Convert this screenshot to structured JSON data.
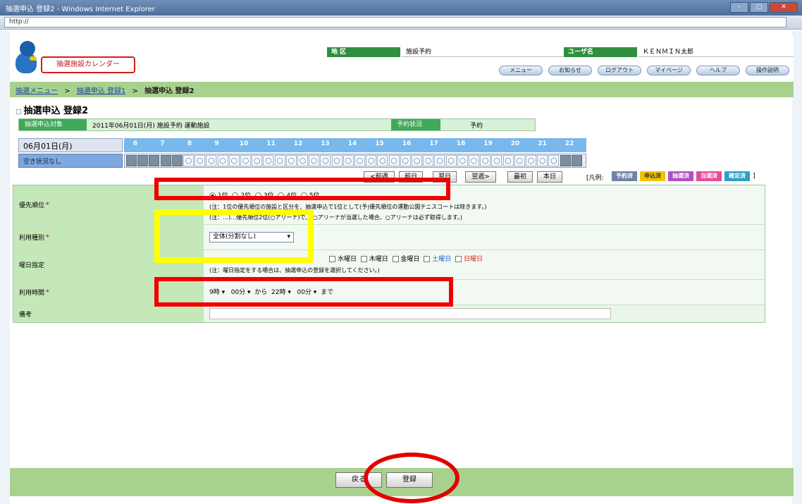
{
  "window": {
    "title": "抽選申込 登録2 - Windows Internet Explorer",
    "url": "http://"
  },
  "header": {
    "calendar_button": "抽選施設カレンダー",
    "area_label": "地 区",
    "area_value": "施設予約",
    "user_label": "ユーザ名",
    "user_value": "ＫＥＮＭＩＮ太郎",
    "nav_buttons": [
      "メニュー",
      "お知らせ",
      "ログアウト",
      "マイページ",
      "ヘルプ",
      "操作説明"
    ]
  },
  "breadcrumb": {
    "items": [
      "抽選メニュー",
      "抽選申込 登録1"
    ],
    "current": "抽選申込 登録2"
  },
  "page": {
    "title": "抽選申込 登録2"
  },
  "summary": {
    "label1": "抽選申込対象",
    "value1": "2011年06月01日(月) 施設予約 運動施設",
    "label2": "予約状況",
    "value2": "予約"
  },
  "schedule": {
    "date": "06月01日(月)",
    "row_label": "空き状況なし",
    "hours": [
      "6",
      "7",
      "8",
      "9",
      "10",
      "11",
      "12",
      "13",
      "14",
      "15",
      "16",
      "17",
      "18",
      "19",
      "20",
      "21",
      "22"
    ],
    "slot_symbol": "○"
  },
  "week_buttons": [
    "<前週",
    "前日",
    "翌日",
    "翌週>",
    "最初",
    "本日"
  ],
  "legend": {
    "title": "[凡例:",
    "chips": [
      {
        "label": "予約済",
        "color": "#6e84a3"
      },
      {
        "label": "申込済",
        "color": "#f3c300"
      },
      {
        "label": "抽選済",
        "color": "#b04fc0"
      },
      {
        "label": "当選済",
        "color": "#e84a9a"
      },
      {
        "label": "確定済",
        "color": "#2f9ec8"
      }
    ],
    "close": "]"
  },
  "form": {
    "priority": {
      "label": "優先順位",
      "options": [
        "1位",
        "2位",
        "3位",
        "4位",
        "5位"
      ],
      "selected": "1位",
      "note1": "(注：1位の優先順位の施設と区分を、抽選申込で1位として(予)優先順位の運動公園テニスコートは除きます。)",
      "note2": "(注：…)…優先順位2位(○アリーナ)で、 ○アリーナが当選した場合、○アリーナは必ず取得します。)"
    },
    "usage": {
      "label": "利用種別",
      "value": "全体(分割なし)"
    },
    "day_spec": {
      "label": "曜日指定",
      "days": [
        "水曜日",
        "木曜日",
        "金曜日",
        "土曜日",
        "日曜日"
      ],
      "note": "(注：曜日指定をする場合は、抽選申込の登録を選択してください。)"
    },
    "time": {
      "label": "利用時間",
      "from_hour": "9時",
      "from_min": "00分",
      "from_suffix": "から",
      "to_hour": "22時",
      "to_min": "00分",
      "to_suffix": "まで"
    },
    "remarks": {
      "label": "備考",
      "value": ""
    }
  },
  "footer": {
    "back": "戻る",
    "confirm": "登録"
  },
  "colors": {
    "brand_green": "#a9d18e",
    "highlight_red": "#f00000",
    "highlight_yellow": "#ffff00"
  }
}
